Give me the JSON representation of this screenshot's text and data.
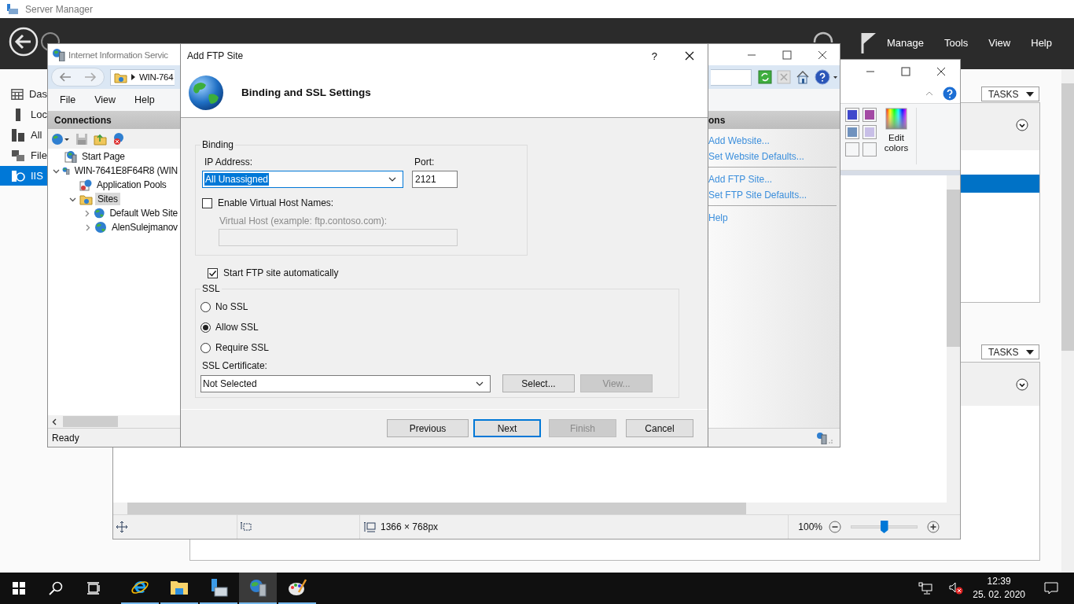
{
  "server_manager": {
    "window_title": "Server Manager",
    "menu": [
      "Manage",
      "Tools",
      "View",
      "Help"
    ],
    "nav": [
      {
        "label": "Das",
        "kind": "dashboard",
        "selected": false
      },
      {
        "label": "Loc",
        "kind": "local",
        "selected": false
      },
      {
        "label": "All",
        "kind": "all",
        "selected": false
      },
      {
        "label": "File",
        "kind": "file",
        "selected": false
      },
      {
        "label": "IIS",
        "kind": "iis",
        "selected": true
      }
    ],
    "tasks": [
      "TASKS",
      "TASKS"
    ]
  },
  "iis": {
    "title": "Internet Information Servic",
    "address": "WIN-764",
    "menu": [
      "File",
      "View",
      "Help"
    ],
    "connections_title": "Connections",
    "tree": [
      {
        "label": "Start Page",
        "kind": "start",
        "selected": false
      },
      {
        "label": "WIN-7641E8F64R8 (WIN",
        "kind": "server",
        "selected": false,
        "expanded": true,
        "children": [
          {
            "label": "Application Pools",
            "kind": "pools",
            "selected": false
          },
          {
            "label": "Sites",
            "kind": "sites",
            "selected": true,
            "expanded": true,
            "children": [
              {
                "label": "Default Web Site",
                "kind": "site",
                "selected": false,
                "expanded": false
              },
              {
                "label": "AlenSulejmanov",
                "kind": "site",
                "selected": false,
                "expanded": false
              }
            ]
          }
        ]
      }
    ],
    "actions_title": "ons",
    "action_groups": [
      [
        "Add Website...",
        "Set Website Defaults..."
      ],
      [
        "Add FTP Site...",
        "Set FTP Site Defaults..."
      ],
      [
        "Help"
      ]
    ],
    "status": "Ready"
  },
  "dialog": {
    "title": "Add FTP Site",
    "help": "?",
    "heading": "Binding and SSL Settings",
    "binding": {
      "legend": "Binding",
      "ip_label": "IP Address:",
      "ip_value": "All Unassigned",
      "port_label": "Port:",
      "port_value": "2121",
      "virtual_hosts": {
        "label": "Enable Virtual Host Names:",
        "checked": false
      },
      "virtual_host_label": "Virtual Host (example: ftp.contoso.com):"
    },
    "start_automatically": {
      "label": "Start FTP site automatically",
      "checked": true
    },
    "ssl": {
      "legend": "SSL",
      "options": [
        {
          "label": "No SSL",
          "selected": false
        },
        {
          "label": "Allow SSL",
          "selected": true
        },
        {
          "label": "Require SSL",
          "selected": false
        }
      ],
      "certificate_label": "SSL Certificate:",
      "certificate_value": "Not Selected",
      "buttons": [
        {
          "label": "Select...",
          "disabled": false
        },
        {
          "label": "View...",
          "disabled": true
        }
      ]
    },
    "buttons": [
      {
        "label": "Previous",
        "disabled": false,
        "default": false
      },
      {
        "label": "Next",
        "disabled": false,
        "default": true
      },
      {
        "label": "Finish",
        "disabled": true,
        "default": false
      },
      {
        "label": "Cancel",
        "disabled": false,
        "default": false
      }
    ]
  },
  "paint": {
    "palette": [
      {
        "kind": "color",
        "color": "#3f48cc"
      },
      {
        "kind": "color",
        "color": "#a349a4"
      },
      {
        "kind": "color",
        "color": "#7092be"
      },
      {
        "kind": "color",
        "color": "#c8bfe7"
      },
      {
        "kind": "empty"
      },
      {
        "kind": "empty"
      }
    ],
    "edit_colors": "Edit colors",
    "dimensions": "1366 × 768px",
    "zoom": "100%",
    "zoom_level": {
      "level": 0.5
    }
  },
  "taskbar": {
    "apps": [
      {
        "kind": "ie",
        "selected": false
      },
      {
        "kind": "explorer",
        "selected": false
      },
      {
        "kind": "server-manager",
        "selected": false
      },
      {
        "kind": "iis",
        "selected": true
      },
      {
        "kind": "paint",
        "selected": false
      }
    ],
    "time": "12:39",
    "date": "25. 02. 2020"
  }
}
